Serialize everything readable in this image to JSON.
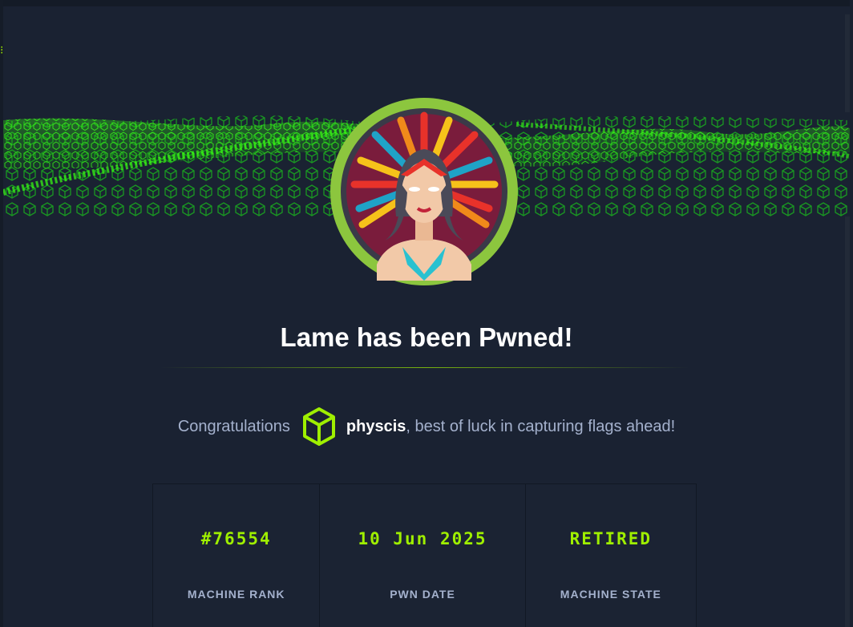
{
  "modal": {
    "title": "Lame has been Pwned!",
    "congrats_prefix": "Congratulations",
    "username": "physcis",
    "congrats_suffix": ", best of luck in capturing flags ahead!"
  },
  "stats": [
    {
      "value": "#76554",
      "label": "MACHINE RANK"
    },
    {
      "value": "10 Jun 2025",
      "label": "PWN DATE"
    },
    {
      "value": "RETIRED",
      "label": "MACHINE STATE"
    }
  ],
  "colors": {
    "accent": "#9fef00",
    "background": "#1a2232",
    "text_muted": "#a4b1cd",
    "text_primary": "#ffffff"
  },
  "icons": [
    "machine-avatar-icon",
    "user-cube-icon"
  ]
}
